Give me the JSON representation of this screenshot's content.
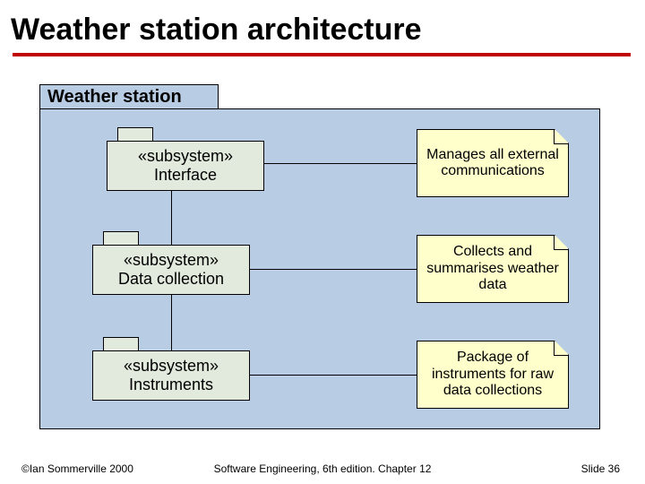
{
  "title": "Weather station architecture",
  "package": {
    "label": "Weather station"
  },
  "subsystems": [
    {
      "stereotype": "«subsystem»",
      "name": "Interface"
    },
    {
      "stereotype": "«subsystem»",
      "name": "Data collection"
    },
    {
      "stereotype": "«subsystem»",
      "name": "Instruments"
    }
  ],
  "notes": [
    {
      "text": "Manages all external communications"
    },
    {
      "text": "Collects and summarises weather data"
    },
    {
      "text": "Package of instruments for raw data collections"
    }
  ],
  "footer": {
    "left": "©Ian Sommerville 2000",
    "center": "Software Engineering, 6th edition. Chapter 12",
    "right": "Slide 36"
  }
}
